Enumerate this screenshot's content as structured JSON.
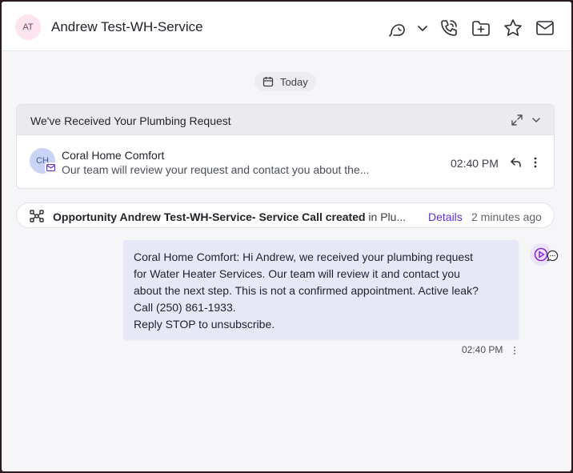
{
  "header": {
    "avatar_initials": "AT",
    "contact_name": "Andrew Test-WH-Service"
  },
  "date_separator": "Today",
  "email": {
    "subject": "We've Received Your Plumbing Request",
    "sender_initials": "CH",
    "sender_name": "Coral Home Comfort",
    "preview": "Our team will review your request and contact you about the...",
    "time": "02:40 PM"
  },
  "activity": {
    "text": "Opportunity Andrew Test-WH-Service- Service Call created",
    "suffix": " in Plu...",
    "details_label": "Details",
    "time_ago": "2 minutes ago"
  },
  "message": {
    "lines": [
      "Coral Home Comfort: Hi Andrew, we received your plumbing request",
      "for Water Heater Services. Our team will review it and contact you",
      "about the next step. This is not a confirmed appointment. Active leak?",
      "Call (250) 861-1933.",
      "Reply STOP to unsubscribe."
    ],
    "time": "02:40 PM"
  },
  "colors": {
    "accent": "#5b2fc9",
    "bubble": "#e6e7f7",
    "avatar_bg": "#fde4ef"
  }
}
